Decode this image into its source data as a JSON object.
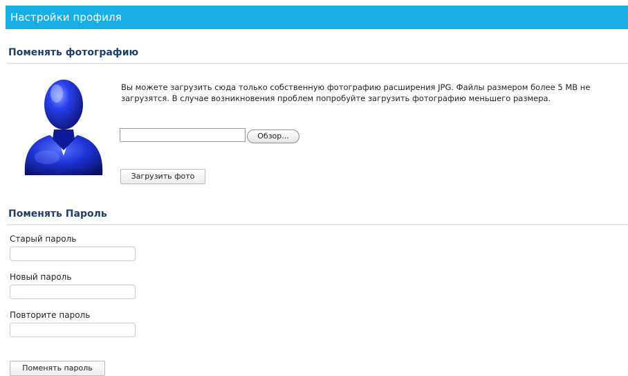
{
  "header": {
    "title": "Настройки профиля"
  },
  "photo_section": {
    "title": "Поменять фотографию",
    "description": "Вы можете загрузить сюда только собственную фотографию расширения JPG. Файлы размером более 5 MB не загрузятся. В случае возникновения проблем попробуйте загрузить фотографию меньшего размера.",
    "file_value": "",
    "browse_label": "Обзор...",
    "upload_label": "Загрузить фото",
    "avatar_icon": "user-silhouette-icon",
    "avatar_color": "#1a2fd8"
  },
  "password_section": {
    "title": "Поменять Пароль",
    "fields": [
      {
        "label": "Старый пароль",
        "value": ""
      },
      {
        "label": "Новый пароль",
        "value": ""
      },
      {
        "label": "Повторите пароль",
        "value": ""
      }
    ],
    "submit_label": "Поменять пароль"
  },
  "colors": {
    "header_bg": "#1aaee6",
    "section_title": "#1f3f6b"
  }
}
